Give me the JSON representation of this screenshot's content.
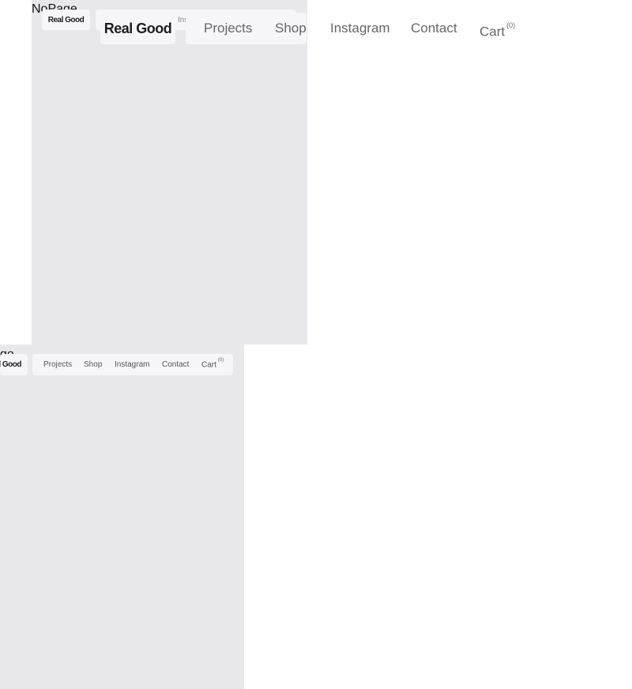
{
  "page": {
    "nopage_label": "NoPage"
  },
  "brand": {
    "logo_text": "Real Good"
  },
  "nav": {
    "projects": "Projects",
    "shop": "Shop",
    "instagram": "Instagram",
    "contact": "Contact",
    "cart": "Cart",
    "cart_count": "(0)"
  },
  "tiny_nav": {
    "instagram_partial": "Ins"
  },
  "colors": {
    "frame_bg": "#e8e8ec",
    "pill_bg": "#f6f6f8",
    "nav_text": "#666666"
  }
}
